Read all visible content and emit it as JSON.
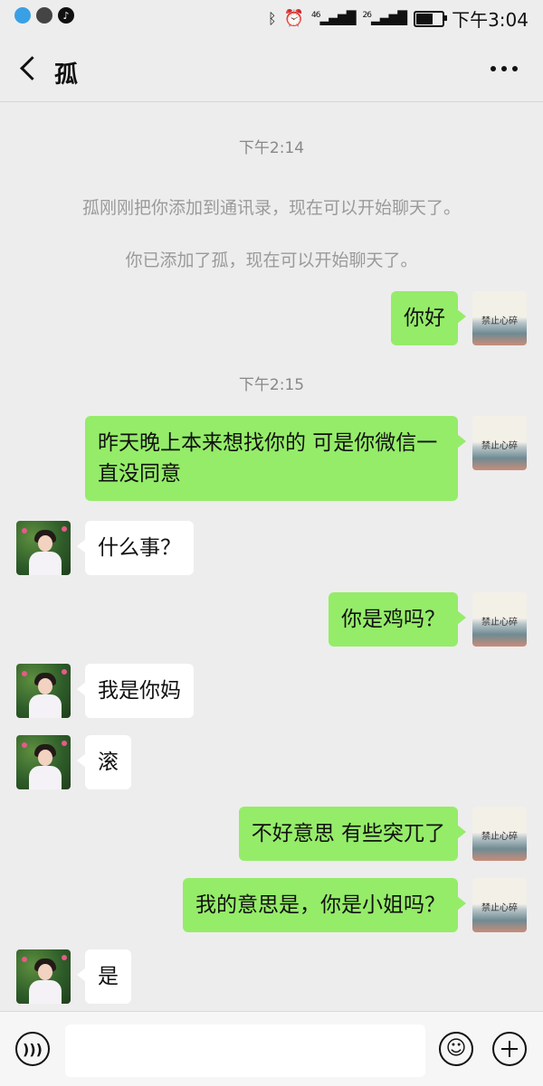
{
  "status_bar": {
    "network_1": "46",
    "network_2": "26",
    "time": "下午3:04"
  },
  "nav": {
    "title": "孤"
  },
  "chat": {
    "time_1": "下午2:14",
    "system_1": "孤刚刚把你添加到通讯录，现在可以开始聊天了。",
    "system_2": "你已添加了孤，现在可以开始聊天了。",
    "time_2": "下午2:15",
    "my_avatar_text": "禁止心碎",
    "messages": [
      {
        "from": "me",
        "text": "你好"
      },
      {
        "from": "me",
        "text": "昨天晚上本来想找你的 可是你微信一直没同意"
      },
      {
        "from": "her",
        "text": "什么事？"
      },
      {
        "from": "me",
        "text": "你是鸡吗？"
      },
      {
        "from": "her",
        "text": "我是你妈"
      },
      {
        "from": "her",
        "text": "滚"
      },
      {
        "from": "me",
        "text": "不好意思 有些突兀了"
      },
      {
        "from": "me",
        "text": "我的意思是，你是小姐吗？"
      },
      {
        "from": "her",
        "text": "是"
      }
    ]
  },
  "input_bar": {
    "value": ""
  },
  "colors": {
    "background": "#ededed",
    "my_bubble": "#95ec69",
    "their_bubble": "#ffffff",
    "system_text": "#9a9a9a"
  }
}
